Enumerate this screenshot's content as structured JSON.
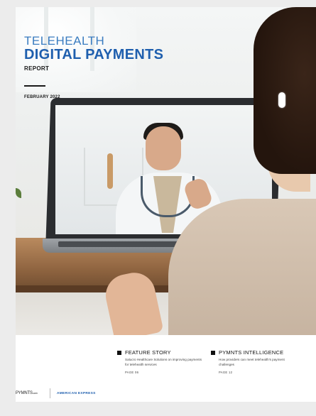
{
  "cover": {
    "kicker": "TELEHEALTH",
    "headline": "DIGITAL PAYMENTS",
    "subhead": "REPORT",
    "date": "FEBRUARY 2022"
  },
  "features": [
    {
      "title": "FEATURE STORY",
      "description": "Salucro Healthcare Solutions on improving payments for telehealth services",
      "page": "PAGE 06"
    },
    {
      "title": "PYMNTS INTELLIGENCE",
      "description": "How providers can meet telehealth's payment challenges",
      "page": "PAGE 12"
    }
  ],
  "brands": {
    "pymnts": "PYMNTS",
    "pymnts_suffix": ".com",
    "partner": "AMERICAN EXPRESS"
  },
  "colors": {
    "accent_blue": "#1f5fae",
    "kicker_blue": "#3a7cc0"
  }
}
